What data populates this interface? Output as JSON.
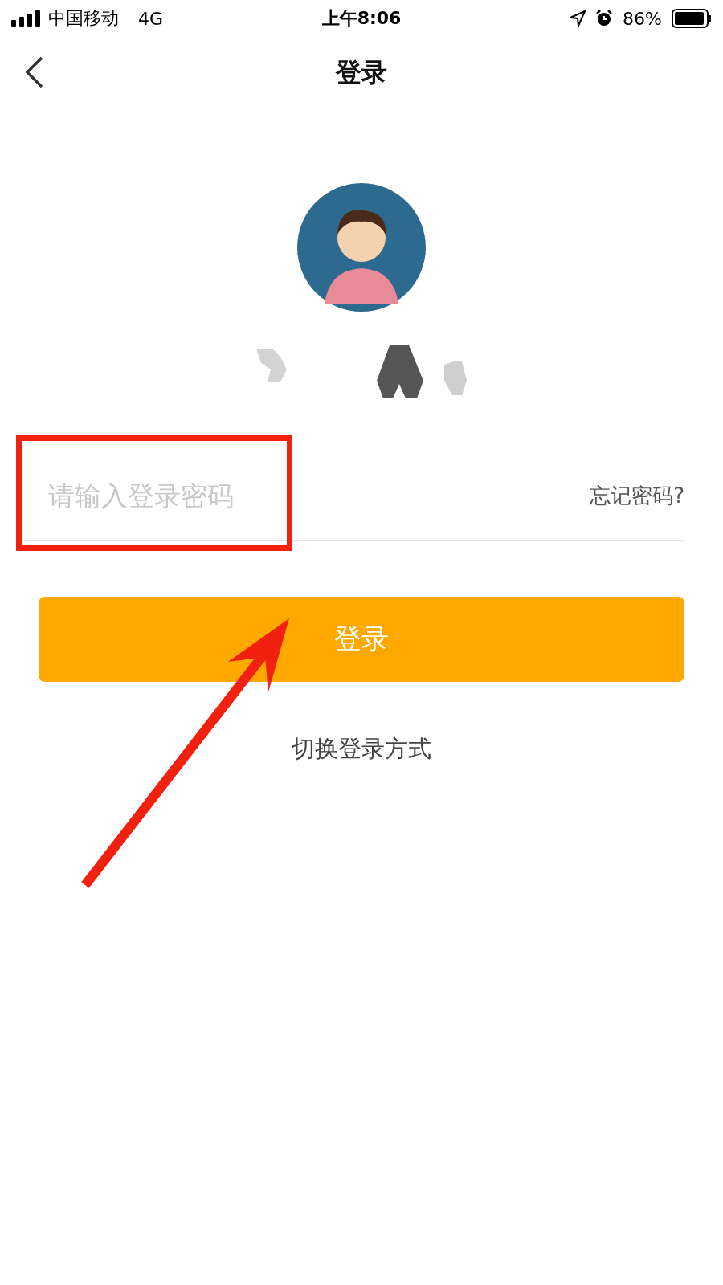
{
  "status_bar": {
    "carrier": "中国移动",
    "network": "4G",
    "time": "上午8:06",
    "battery": "86%"
  },
  "nav": {
    "title": "登录"
  },
  "password_field": {
    "placeholder": "请输入登录密码"
  },
  "forgot_link": "忘记密码?",
  "login_button": "登录",
  "switch_link": "切换登录方式"
}
